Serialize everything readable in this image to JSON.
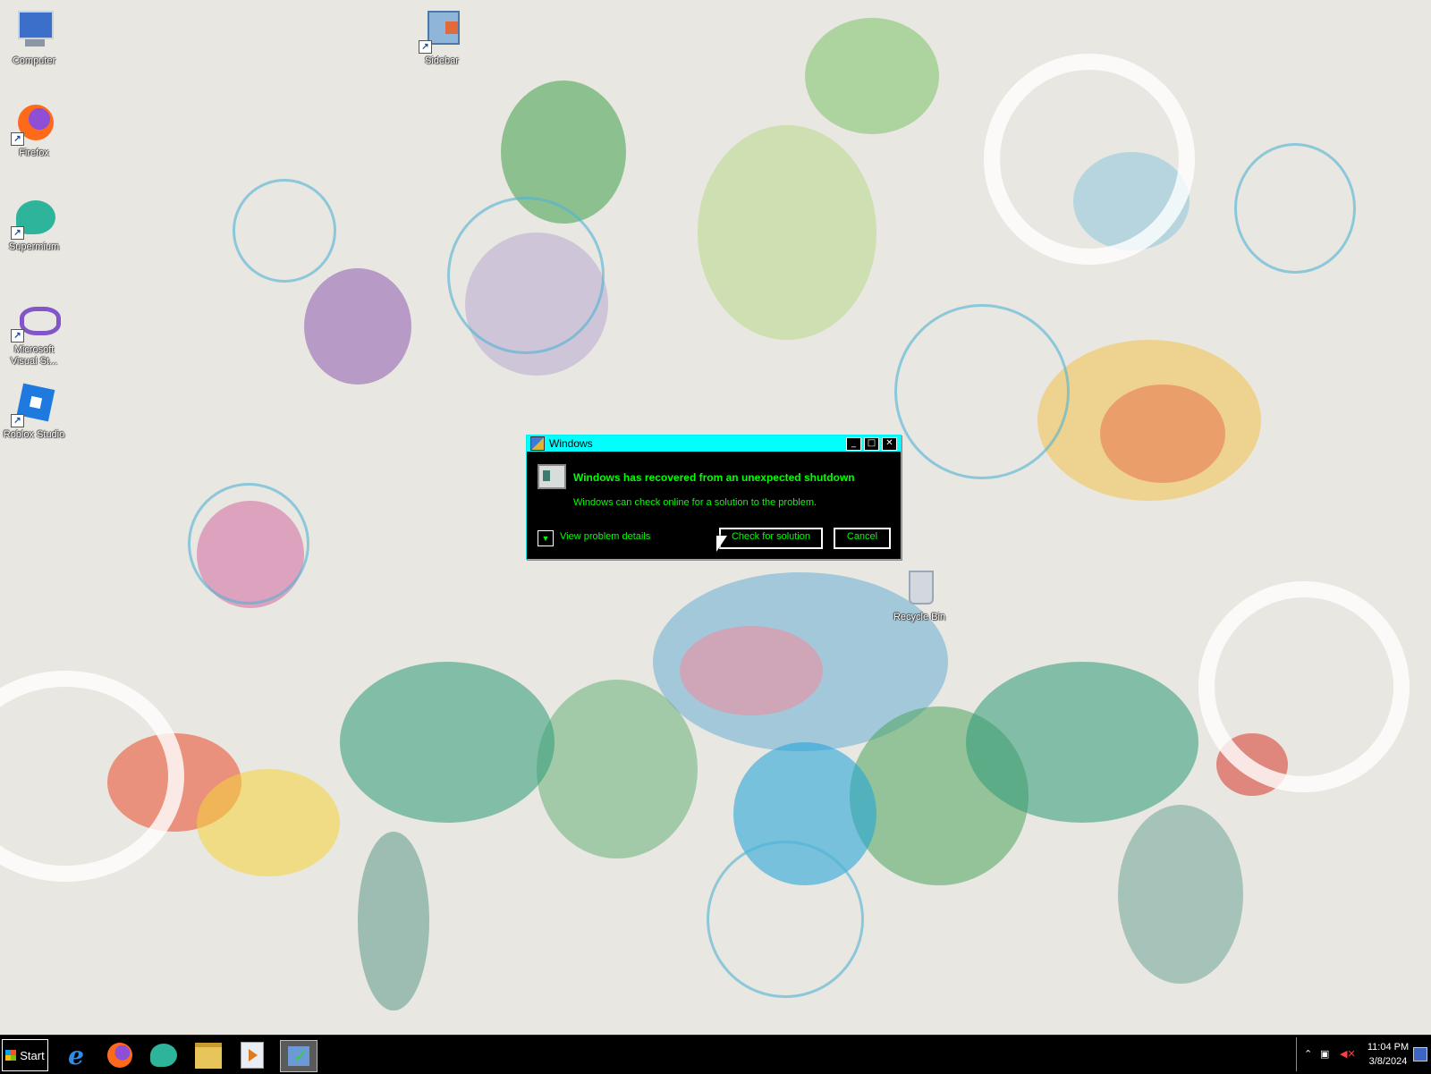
{
  "desktop": {
    "icons": [
      {
        "label": "Computer",
        "icon": "computer-icon"
      },
      {
        "label": "Firefox",
        "icon": "firefox-icon"
      },
      {
        "label": "Supermium",
        "icon": "supermium-icon"
      },
      {
        "label": "Microsoft Visual St...",
        "icon": "visual-studio-icon"
      },
      {
        "label": "Roblox Studio",
        "icon": "roblox-studio-icon"
      },
      {
        "label": "Sidebar",
        "icon": "sidebar-icon"
      },
      {
        "label": "Recycle Bin",
        "icon": "recycle-bin-icon"
      }
    ]
  },
  "dialog": {
    "title": "Windows",
    "heading": "Windows has recovered from an unexpected shutdown",
    "message": "Windows can check online for a solution to the problem.",
    "details_label": "View problem details",
    "check_button": "Check for solution",
    "cancel_button": "Cancel",
    "controls": {
      "minimize": "_",
      "maximize": "□",
      "close": "✕"
    }
  },
  "taskbar": {
    "start_label": "Start",
    "pinned": [
      "internet-explorer-icon",
      "firefox-icon",
      "supermium-icon",
      "file-explorer-icon",
      "media-player-icon",
      "action-center-icon"
    ],
    "clock": {
      "time": "11:04 PM",
      "date": "3/8/2024"
    }
  },
  "colors": {
    "dialog_title_bg": "#00ffff",
    "dialog_bg": "#000000",
    "dialog_text": "#00ff00",
    "taskbar_bg": "#000000"
  }
}
